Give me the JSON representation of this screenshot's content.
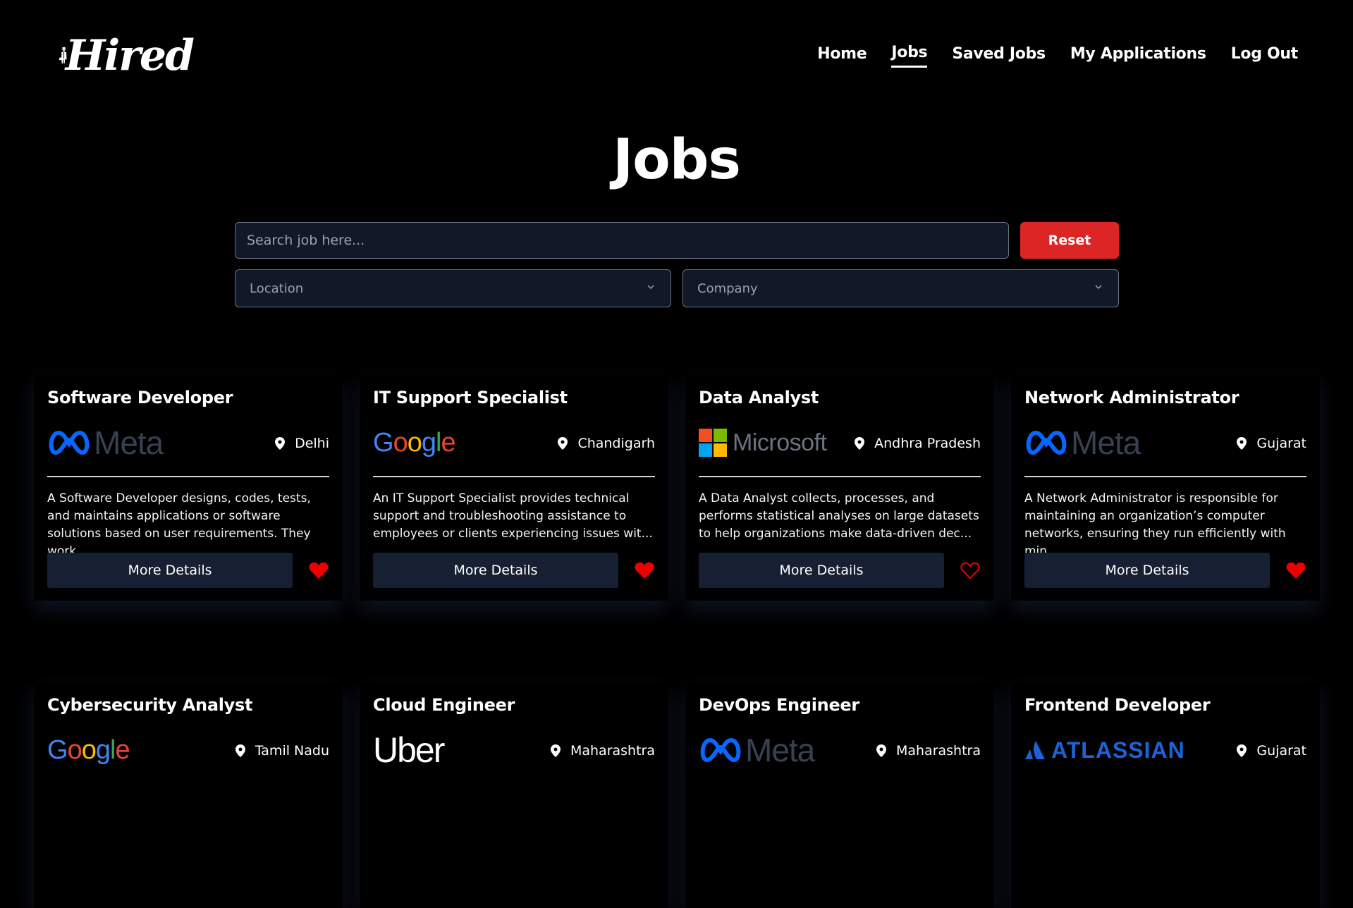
{
  "app": {
    "logo_text": "Hired"
  },
  "nav": {
    "items": [
      {
        "label": "Home",
        "active": false
      },
      {
        "label": "Jobs",
        "active": true
      },
      {
        "label": "Saved Jobs",
        "active": false
      },
      {
        "label": "My Applications",
        "active": false
      },
      {
        "label": "Log Out",
        "active": false
      }
    ]
  },
  "page": {
    "title": "Jobs"
  },
  "search": {
    "placeholder": "Search job here...",
    "value": "",
    "reset_label": "Reset"
  },
  "filters": {
    "location_placeholder": "Location",
    "company_placeholder": "Company"
  },
  "colors": {
    "accent_red": "#dc2626",
    "card_button": "#172033",
    "heart_red": "#ef0000"
  },
  "jobs": [
    {
      "title": "Software Developer",
      "company": "Meta",
      "location": "Delhi",
      "description": "A Software Developer designs, codes, tests, and maintains applications or software solutions based on user requirements. They work...",
      "button_label": "More Details",
      "saved": true
    },
    {
      "title": "IT Support Specialist",
      "company": "Google",
      "location": "Chandigarh",
      "description": "An IT Support Specialist provides technical support and troubleshooting assistance to employees or clients experiencing issues wit...",
      "button_label": "More Details",
      "saved": true
    },
    {
      "title": "Data Analyst",
      "company": "Microsoft",
      "location": "Andhra Pradesh",
      "description": "A Data Analyst collects, processes, and performs statistical analyses on large datasets to help organizations make data-driven dec...",
      "button_label": "More Details",
      "saved": false
    },
    {
      "title": "Network Administrator",
      "company": "Meta",
      "location": "Gujarat",
      "description": "A Network Administrator is responsible for maintaining an organization’s computer networks, ensuring they run efficiently with min...",
      "button_label": "More Details",
      "saved": true
    },
    {
      "title": "Cybersecurity Analyst",
      "company": "Google",
      "location": "Tamil Nadu"
    },
    {
      "title": "Cloud Engineer",
      "company": "Uber",
      "location": "Maharashtra"
    },
    {
      "title": "DevOps Engineer",
      "company": "Meta",
      "location": "Maharashtra"
    },
    {
      "title": "Frontend Developer",
      "company": "ATLASSIAN",
      "location": "Gujarat"
    }
  ]
}
